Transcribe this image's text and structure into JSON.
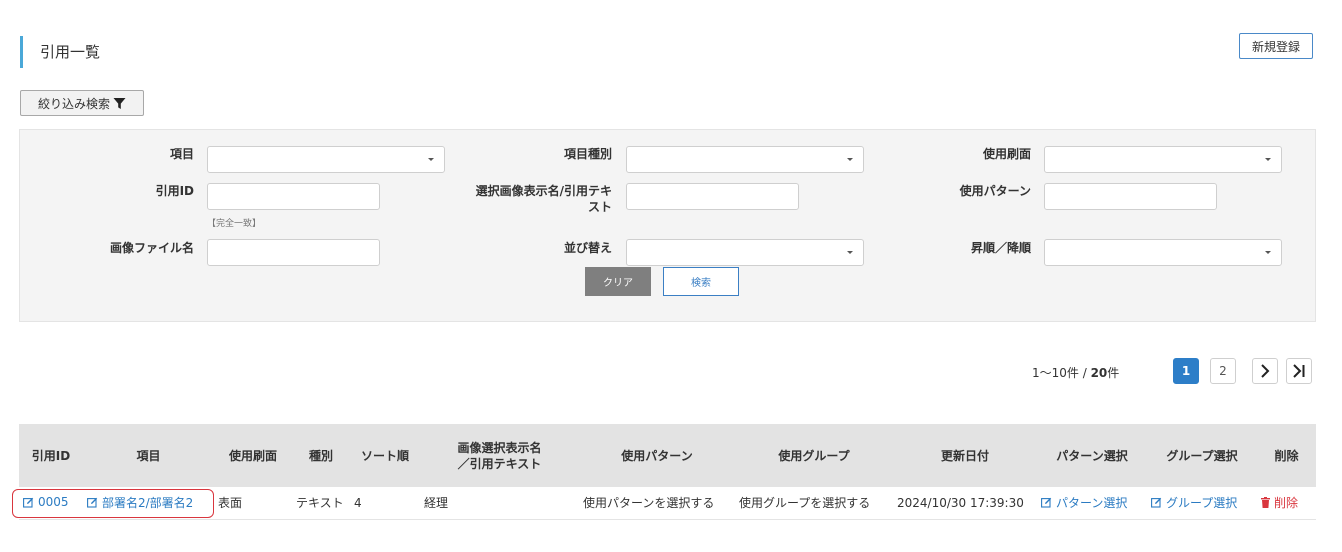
{
  "page": {
    "title": "引用一覧",
    "new_button": "新規登録",
    "filter_button": "絞り込み検索"
  },
  "filters": {
    "item": {
      "label": "項目",
      "value": ""
    },
    "item_type": {
      "label": "項目種別",
      "value": ""
    },
    "usage_screen": {
      "label": "使用刷面",
      "value": ""
    },
    "citation_id": {
      "label": "引用ID",
      "value": "",
      "hint": "【完全一致】"
    },
    "selection_text": {
      "label_line1": "選択画像表示名/引用テキ",
      "label_line2": "スト",
      "value": ""
    },
    "usage_pattern": {
      "label": "使用パターン",
      "value": ""
    },
    "image_file": {
      "label": "画像ファイル名",
      "value": ""
    },
    "sort": {
      "label": "並び替え",
      "value": ""
    },
    "order": {
      "label": "昇順／降順",
      "value": ""
    },
    "clear_button": "クリア",
    "search_button": "検索"
  },
  "pagination": {
    "range": "1〜10件 / ",
    "total": "20",
    "unit": "件",
    "pages": [
      "1",
      "2"
    ],
    "current": "1",
    "next": "〉",
    "last": "〉|"
  },
  "table": {
    "headers": {
      "id": "引用ID",
      "item": "項目",
      "screen": "使用刷面",
      "type": "種別",
      "sort": "ソート順",
      "disp_line1": "画像選択表示名",
      "disp_line2": "／引用テキスト",
      "pattern": "使用パターン",
      "group": "使用グループ",
      "updated": "更新日付",
      "pattern_sel": "パターン選択",
      "group_sel": "グループ選択",
      "delete": "削除"
    },
    "rows": [
      {
        "id": "0005",
        "item": "部署名2/部署名2",
        "screen": "表面",
        "type": "テキスト",
        "sort": "4",
        "display": "経理",
        "pattern": "使用パターンを選択する",
        "group": "使用グループを選択する",
        "updated": "2024/10/30 17:39:30",
        "pattern_sel": "パターン選択",
        "group_sel": "グループ選択",
        "delete": "削除"
      }
    ]
  },
  "colors": {
    "accent": "#4aa8d8",
    "link": "#2b7bc2",
    "danger": "#d9363e",
    "active_page": "#2d7ec8"
  }
}
